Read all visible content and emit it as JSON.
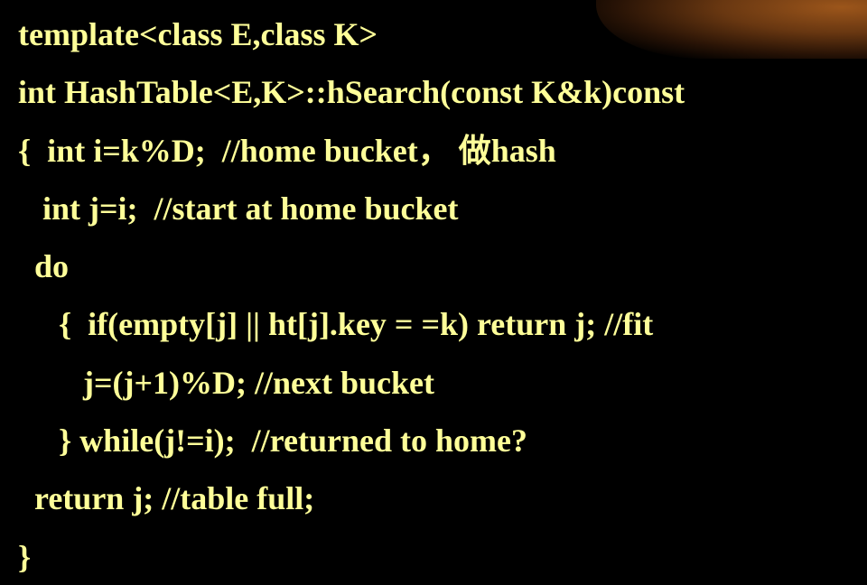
{
  "slide": {
    "accent_color": "#ffff99",
    "background_color": "#000000",
    "corner_decoration_color": "#a45a1c",
    "code_lines": [
      "template<class E,class K>",
      "int HashTable<E,K>::hSearch(const K&k)const",
      "{  int i=k%D;  //home bucket， 做hash",
      "   int j=i;  //start at home bucket",
      "  do",
      "     {  if(empty[j] || ht[j].key = =k) return j; //fit",
      "        j=(j+1)%D; //next bucket",
      "     } while(j!=i);  //returned to home?",
      "  return j; //table full;",
      "}"
    ]
  }
}
